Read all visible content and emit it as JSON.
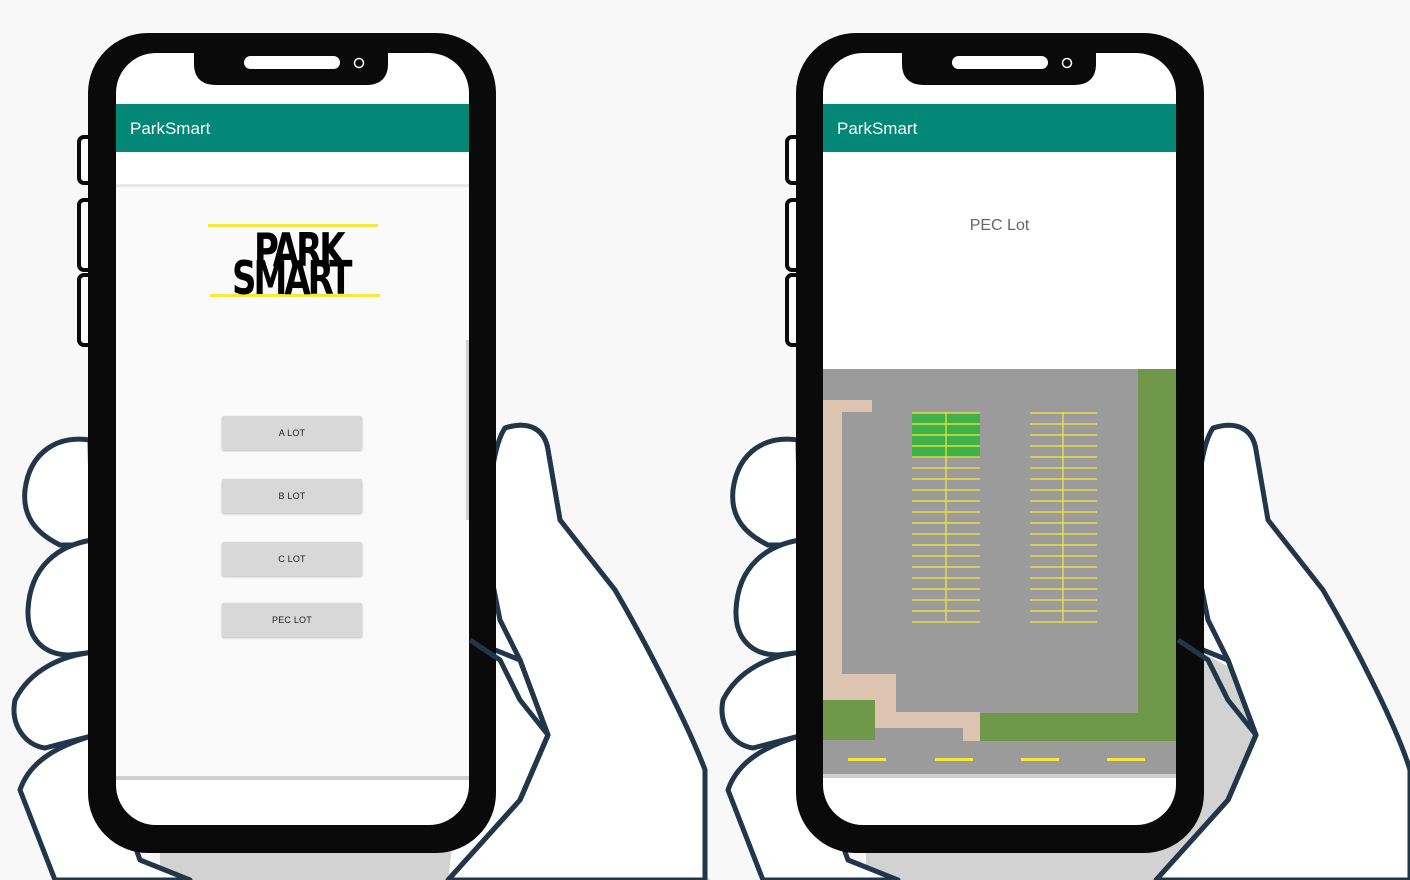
{
  "left_phone": {
    "app_title": "ParkSmart",
    "logo_lines": [
      "PARK",
      "SMART"
    ],
    "buttons": [
      "A LOT",
      "B LOT",
      "C LOT",
      "PEC LOT"
    ]
  },
  "right_phone": {
    "app_title": "ParkSmart",
    "lot_title": "PEC Lot"
  },
  "colors": {
    "app_bar": "#038777",
    "asphalt": "#9b9b9b",
    "grass": "#70984a",
    "sidewalk": "#dcc4b0",
    "stripe": "#f5e83a",
    "open_spot": "#3fb04a",
    "hand_outline": "#213648",
    "phone_body": "#0a0a0a"
  }
}
